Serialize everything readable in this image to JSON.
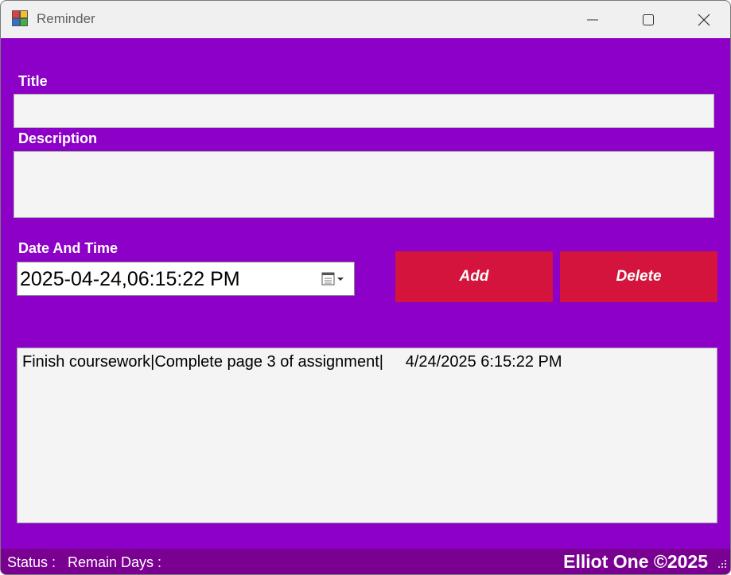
{
  "window": {
    "title": "Reminder",
    "icons": [
      "app-icon",
      "minimize-icon",
      "maximize-icon",
      "close-icon"
    ]
  },
  "form": {
    "title_label": "Title",
    "title_value": "",
    "description_label": "Description",
    "description_value": "",
    "datetime_label": "Date And Time",
    "datetime_value": "2025-04-24,06:15:22 PM",
    "add_label": "Add",
    "delete_label": "Delete"
  },
  "list": {
    "items": [
      {
        "text": "Finish coursework|Complete page 3 of assignment|     4/24/2025 6:15:22 PM"
      }
    ]
  },
  "status": {
    "status_label": "Status :",
    "remain_days_label": "Remain Days :",
    "copyright": "Elliot One ©2025"
  },
  "colors": {
    "background": "#8c00c8",
    "button": "#d4143c",
    "statusbar": "#7a0092",
    "field": "#f4f4f4"
  }
}
